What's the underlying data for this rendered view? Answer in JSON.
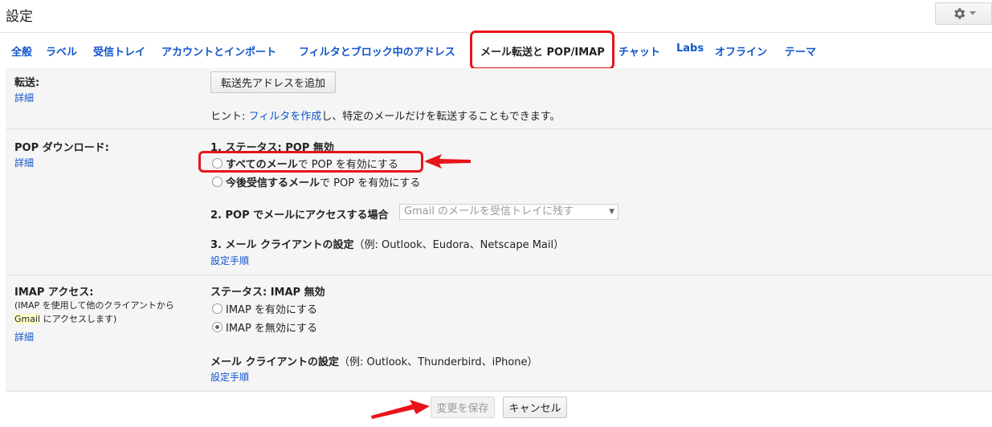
{
  "header": {
    "title": "設定"
  },
  "tabs": [
    {
      "label": "全般"
    },
    {
      "label": "ラベル"
    },
    {
      "label": "受信トレイ"
    },
    {
      "label": "アカウントとインポート"
    },
    {
      "label": "フィルタとブロック中のアドレス"
    },
    {
      "label": "メール転送と POP/IMAP"
    },
    {
      "label": "チャット"
    },
    {
      "label": "Labs"
    },
    {
      "label": "オフライン"
    },
    {
      "label": "テーマ"
    }
  ],
  "forwarding": {
    "label": "転送:",
    "details_link": "詳細",
    "add_button": "転送先アドレスを追加",
    "hint_prefix": "ヒント: ",
    "hint_link": "フィルタを作成",
    "hint_suffix": "し、特定のメールだけを転送することもできます。"
  },
  "pop": {
    "label": "POP ダウンロード:",
    "details_link": "詳細",
    "status": "1. ステータス: POP 無効",
    "option_all_bold": "すべてのメール",
    "option_all_rest": "で POP を有効にする",
    "option_future_bold": "今後受信するメール",
    "option_future_rest": "で POP を有効にする",
    "access_label": "2. POP でメールにアクセスする場合",
    "access_select": "Gmail のメールを受信トレイに残す",
    "client_label_bold": "3. メール クライアントの設定",
    "client_label_rest": "（例: Outlook、Eudora、Netscape Mail）",
    "client_link": "設定手順"
  },
  "imap": {
    "label": "IMAP アクセス:",
    "desc_line1": "(IMAP を使用して他のクライアントから",
    "desc_gmail": "Gmail",
    "desc_line2_rest": " にアクセスします)",
    "details_link": "詳細",
    "status": "ステータス: IMAP 無効",
    "option_enable": "IMAP を有効にする",
    "option_disable": "IMAP を無効にする",
    "client_label_bold": "メール クライアントの設定",
    "client_label_rest": "（例: Outlook、Thunderbird、iPhone）",
    "client_link": "設定手順"
  },
  "footer": {
    "save_button": "変更を保存",
    "cancel_button": "キャンセル"
  },
  "colors": {
    "accent_link": "#1155cc",
    "annotation_red": "#e8141a"
  }
}
